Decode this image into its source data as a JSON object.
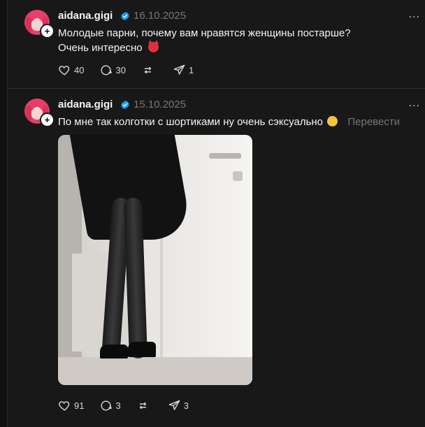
{
  "posts": [
    {
      "username": "aidana.gigi",
      "date": "16.10.2025",
      "text_lines": [
        "Молодые парни, почему вам нравятся женщины постарше?",
        "Очень интересно"
      ],
      "emoji": "devil-emoji",
      "actions": {
        "likes": "40",
        "comments": "30",
        "reposts": "",
        "shares": "1"
      }
    },
    {
      "username": "aidana.gigi",
      "date": "15.10.2025",
      "text": "По мне так колготки с шортиками ну очень сэксуально",
      "emoji": "smirk-emoji",
      "translate": "Перевести",
      "image": "photo",
      "actions": {
        "likes": "91",
        "comments": "3",
        "reposts": "",
        "shares": "3"
      }
    }
  ],
  "more_label": "..."
}
